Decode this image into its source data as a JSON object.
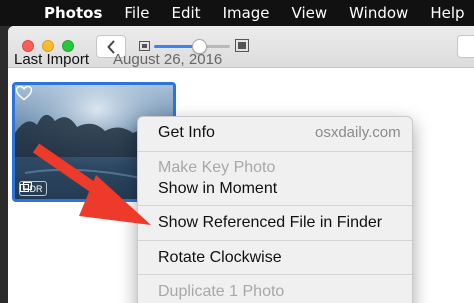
{
  "menubar": {
    "app_name": "Photos",
    "items": [
      "File",
      "Edit",
      "Image",
      "View",
      "Window",
      "Help"
    ]
  },
  "toolbar": {
    "zoom_level": 0.6
  },
  "import_header": {
    "title": "Last Import",
    "date": "August 26, 2016"
  },
  "thumbnail": {
    "badge": "HDR"
  },
  "context_menu": {
    "items": [
      {
        "label": "Get Info",
        "enabled": true
      },
      {
        "label": "Make Key Photo",
        "enabled": false
      },
      {
        "label": "Show in Moment",
        "enabled": true
      },
      {
        "label": "Show Referenced File in Finder",
        "enabled": true
      },
      {
        "label": "Rotate Clockwise",
        "enabled": true
      },
      {
        "label": "Duplicate 1 Photo",
        "enabled": false
      }
    ],
    "watermark": "osxdaily.com"
  },
  "colors": {
    "selection": "#2d74da",
    "annotation_arrow": "#ee3a2a",
    "close": "#fc5f57",
    "minimize": "#fdbc2e",
    "zoom": "#27c83f"
  }
}
